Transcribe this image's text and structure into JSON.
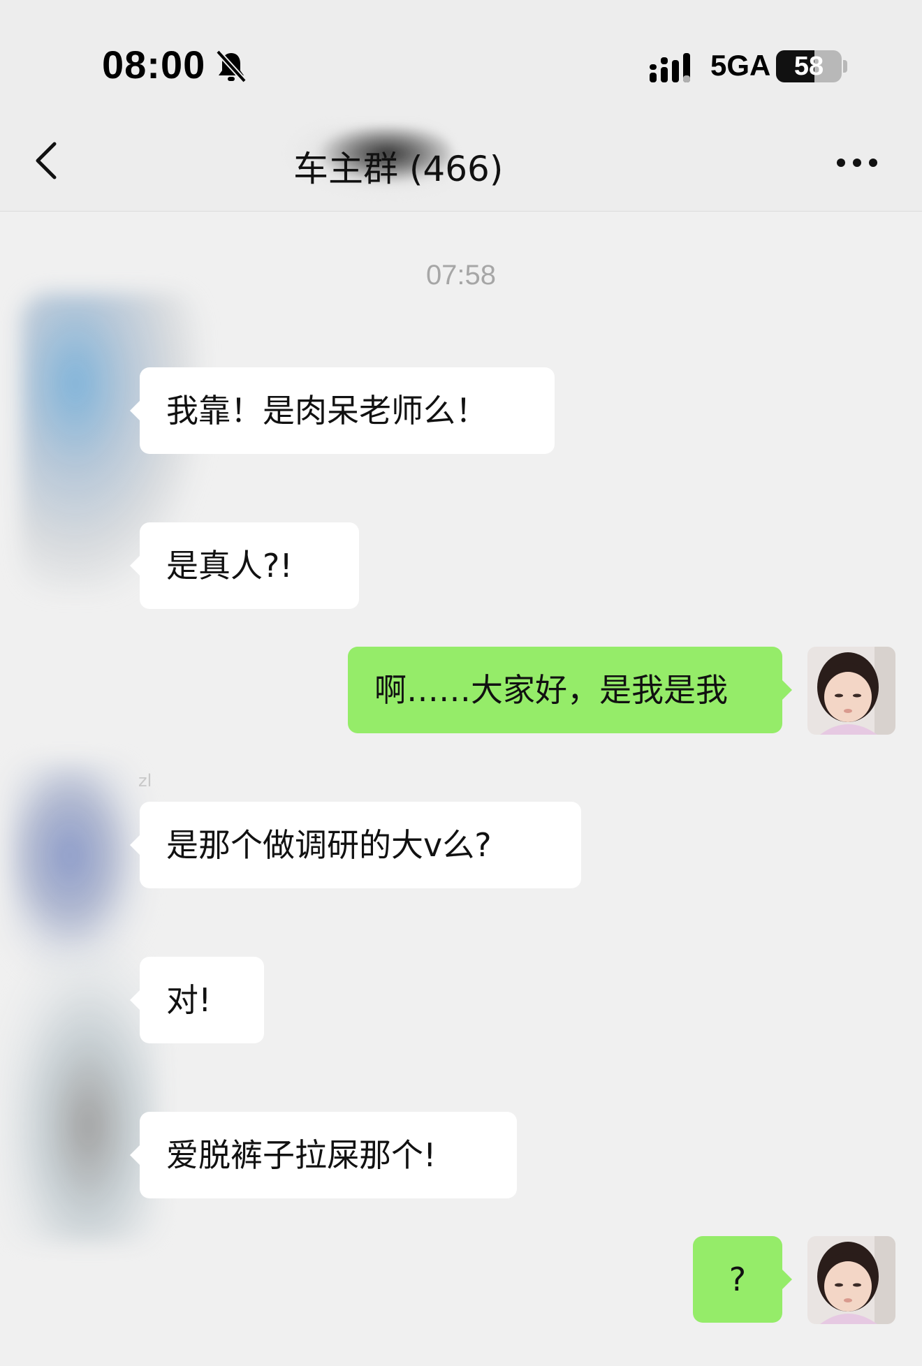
{
  "status_bar": {
    "time": "08:00",
    "mute_icon": "bell-slash-icon",
    "signal_icon": "cellular-signal-icon",
    "network": "5GA",
    "battery_percent": 58,
    "battery_text": "58"
  },
  "nav": {
    "back_icon": "chevron-left-icon",
    "title": "车主群 (466)",
    "more_icon": "ellipsis-icon"
  },
  "chat": {
    "timestamp": "07:58",
    "sender_name": "zl",
    "messages": [
      {
        "side": "left",
        "text": "我靠！是肉呆老师么！"
      },
      {
        "side": "left",
        "text": "是真人?!"
      },
      {
        "side": "right",
        "text": "啊……大家好，是我是我"
      },
      {
        "side": "left",
        "text": "是那个做调研的大v么?"
      },
      {
        "side": "left",
        "text": "对!"
      },
      {
        "side": "left",
        "text": "爱脱裤子拉屎那个!"
      },
      {
        "side": "right",
        "text": "?"
      }
    ]
  },
  "colors": {
    "background": "#f0f0f0",
    "self_bubble": "#95ec69",
    "other_bubble": "#ffffff",
    "timestamp": "#a6a6a6"
  }
}
